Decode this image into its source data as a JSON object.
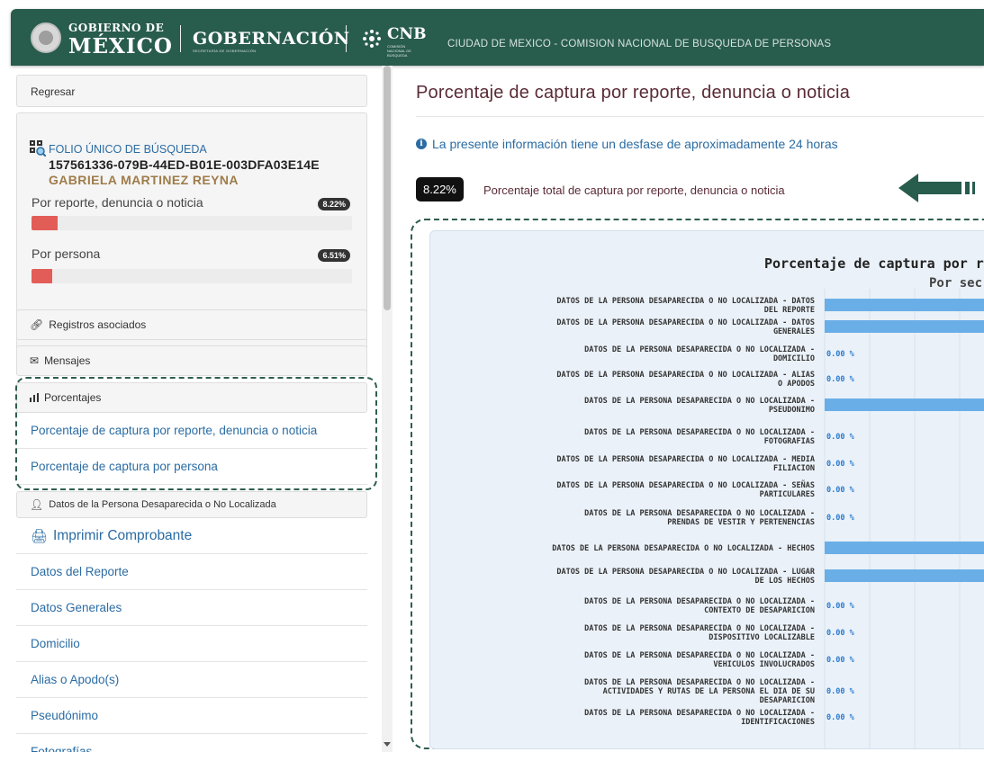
{
  "header": {
    "gob_small": "GOBIERNO DE",
    "gob_big": "MÉXICO",
    "gobernacion": "GOBERNACIÓN",
    "gobernacion_sub": "SECRETARÍA DE GOBERNACIÓN",
    "cnb": "CNB",
    "cnb_sub": "COMISIÓN NACIONAL DE BÚSQUEDA",
    "title": "CIUDAD DE MEXICO - COMISION NACIONAL DE BUSQUEDA DE PERSONAS"
  },
  "sidebar": {
    "back": "Regresar",
    "folio_label": "FOLIO ÚNICO DE BÚSQUEDA",
    "folio_id": "157561336-079B-44ED-B01E-003DFA03E14E",
    "person_name": "GABRIELA MARTINEZ REYNA",
    "progress": [
      {
        "label": "Por reporte, denuncia o noticia",
        "badge": "8.22%",
        "value": 8.22
      },
      {
        "label": "Por persona",
        "badge": "6.51%",
        "value": 6.51
      }
    ],
    "registros": "Registros asociados",
    "mensajes": "Mensajes",
    "porcentajes": "Porcentajes",
    "pct_items": [
      "Porcentaje de captura por reporte, denuncia o noticia",
      "Porcentaje de captura por persona"
    ],
    "datos_header": "Datos de la Persona Desaparecida o No Localizada",
    "imprimir": "Imprimir Comprobante",
    "items": [
      "Datos del Reporte",
      "Datos Generales",
      "Domicilio",
      "Alias o Apodo(s)",
      "Pseudónimo",
      "Fotografías"
    ]
  },
  "main": {
    "title": "Porcentaje de captura por reporte, denuncia o noticia",
    "info": "La presente información tiene un desfase de aproximadamente 24 horas",
    "total_badge": "8.22%",
    "total_text": "Porcentaje total de captura por reporte, denuncia o noticia"
  },
  "colors": {
    "header_green": "#285c4d",
    "link_blue": "#2b6ca3",
    "title_wine": "#5a2b37",
    "bar_blue": "#6aaee8",
    "progress_red": "#e35d58"
  },
  "chart_data": {
    "type": "bar",
    "orientation": "horizontal",
    "title": "Porcentaje de captura por re",
    "subtitle": "Por sec",
    "categories": [
      [
        "DATOS DE LA PERSONA DESAPARECIDA O NO LOCALIZADA - DATOS",
        "DEL REPORTE"
      ],
      [
        "DATOS DE LA PERSONA DESAPARECIDA O NO LOCALIZADA - DATOS",
        "GENERALES"
      ],
      [
        "DATOS DE LA PERSONA DESAPARECIDA O NO LOCALIZADA -",
        "DOMICILIO"
      ],
      [
        "DATOS DE LA PERSONA DESAPARECIDA O NO LOCALIZADA - ALIAS",
        "O APODOS"
      ],
      [
        "DATOS DE LA PERSONA DESAPARECIDA O NO LOCALIZADA -",
        "PSEUDONIMO"
      ],
      [
        "DATOS DE LA PERSONA DESAPARECIDA O NO LOCALIZADA -",
        "FOTOGRAFIAS"
      ],
      [
        "DATOS DE LA PERSONA DESAPARECIDA O NO LOCALIZADA - MEDIA",
        "FILIACION"
      ],
      [
        "DATOS DE LA PERSONA DESAPARECIDA O NO LOCALIZADA - SEÑAS",
        "PARTICULARES"
      ],
      [
        "DATOS DE LA PERSONA DESAPARECIDA O NO LOCALIZADA -",
        "PRENDAS DE VESTIR Y PERTENENCIAS"
      ],
      [
        "DATOS DE LA PERSONA DESAPARECIDA O NO LOCALIZADA - HECHOS"
      ],
      [
        "DATOS DE LA PERSONA DESAPARECIDA O NO LOCALIZADA - LUGAR",
        "DE LOS HECHOS"
      ],
      [
        "DATOS DE LA PERSONA DESAPARECIDA O NO LOCALIZADA -",
        "CONTEXTO DE DESAPARICION"
      ],
      [
        "DATOS DE LA PERSONA DESAPARECIDA O NO LOCALIZADA -",
        "DISPOSITIVO LOCALIZABLE"
      ],
      [
        "DATOS DE LA PERSONA DESAPARECIDA O NO LOCALIZADA -",
        "VEHICULOS INVOLUCRADOS"
      ],
      [
        "DATOS DE LA PERSONA DESAPARECIDA O NO LOCALIZADA -",
        "ACTIVIDADES Y RUTAS DE LA PERSONA EL DIA DE SU",
        "DESAPARICION"
      ],
      [
        "DATOS DE LA PERSONA DESAPARECIDA O NO LOCALIZADA -",
        "IDENTIFICACIONES"
      ]
    ],
    "value_labels": [
      "",
      "",
      "0.00 %",
      "0.00 %",
      "",
      "0.00 %",
      "0.00 %",
      "0.00 %",
      "0.00 %",
      "",
      "",
      "0.00 %",
      "0.00 %",
      "0.00 %",
      "0.00 %",
      "0.00 %"
    ],
    "has_bar": [
      true,
      true,
      false,
      false,
      true,
      false,
      false,
      false,
      false,
      true,
      true,
      false,
      false,
      false,
      false,
      false
    ]
  }
}
